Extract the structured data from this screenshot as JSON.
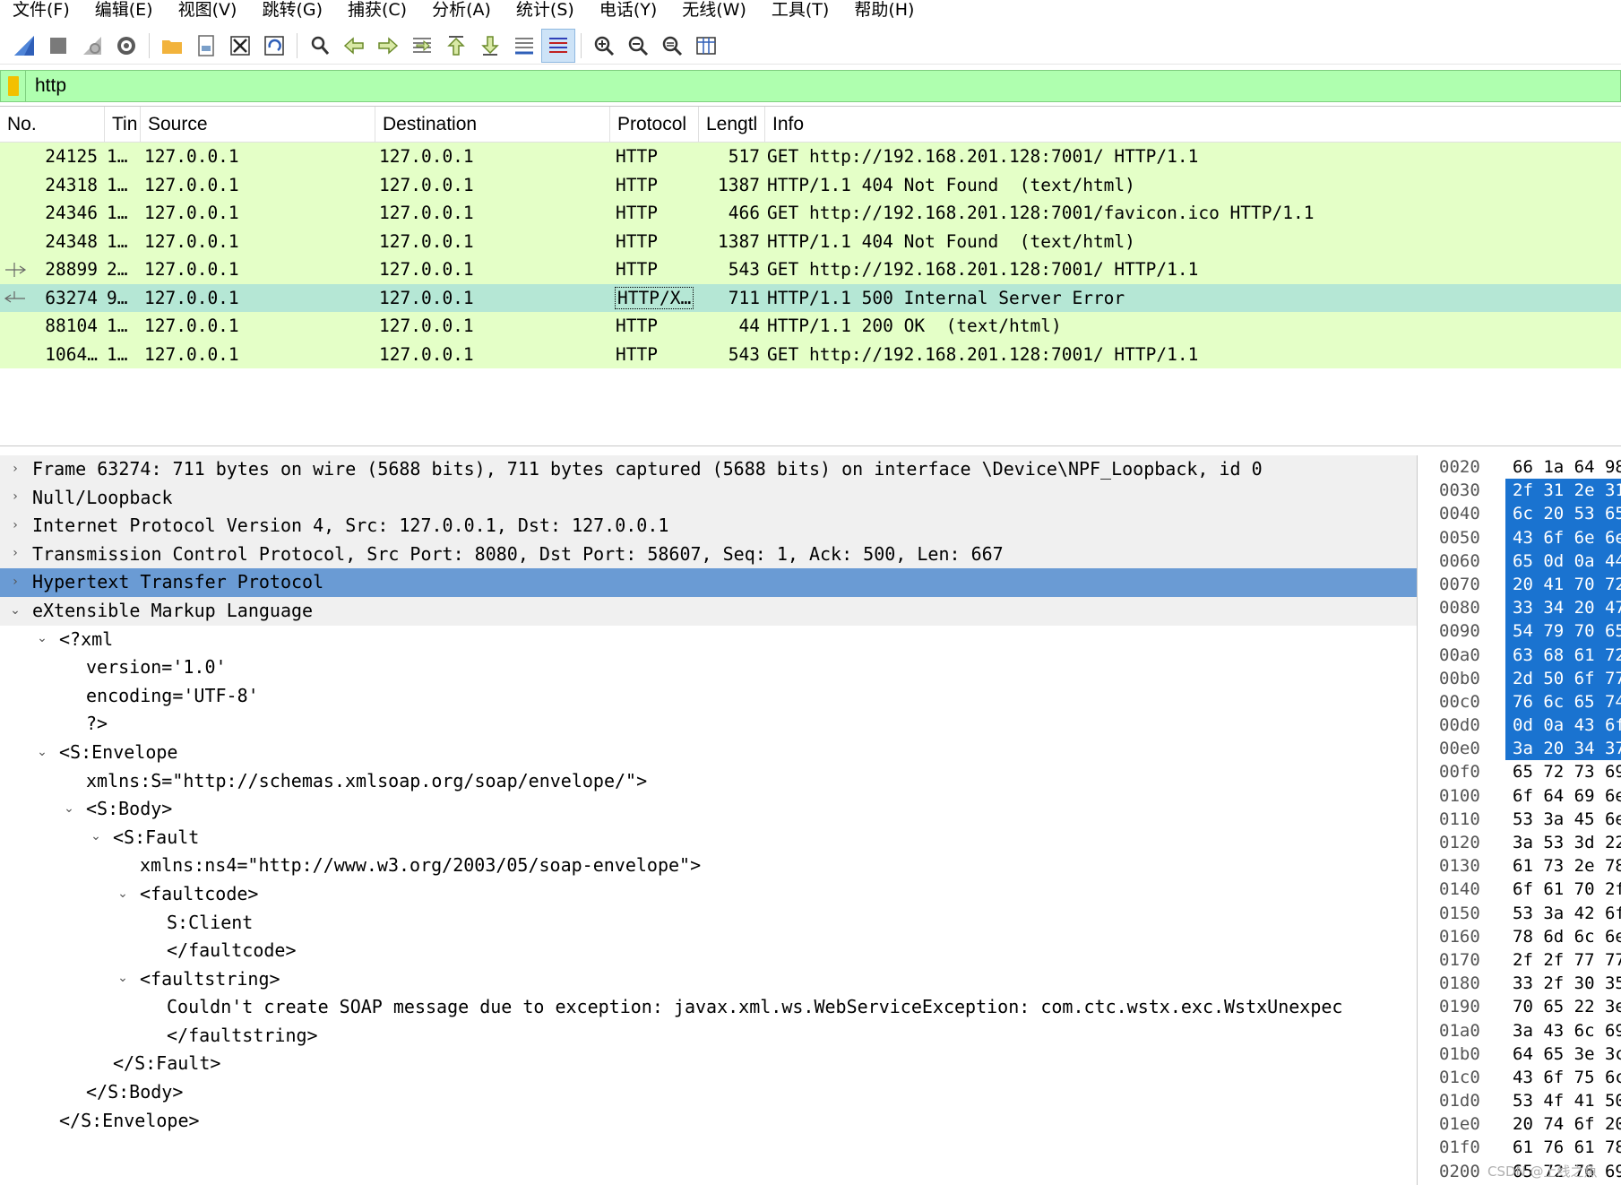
{
  "menu": [
    "文件(F)",
    "编辑(E)",
    "视图(V)",
    "跳转(G)",
    "捕获(C)",
    "分析(A)",
    "统计(S)",
    "电话(Y)",
    "无线(W)",
    "工具(T)",
    "帮助(H)"
  ],
  "toolbar": {
    "buttons": [
      "start-capture-icon",
      "stop-capture-icon",
      "restart-capture-icon",
      "capture-options-icon",
      "open-file-icon",
      "file-set-icon",
      "close-file-icon",
      "reload-file-icon",
      "find-packet-icon",
      "go-back-icon",
      "go-forward-icon",
      "go-to-packet-icon",
      "first-packet-icon",
      "last-packet-icon",
      "auto-scroll-icon",
      "colorize-icon",
      "zoom-in-icon",
      "zoom-out-icon",
      "normal-size-icon",
      "resize-columns-icon"
    ]
  },
  "filter": {
    "value": "http"
  },
  "packet_list": {
    "columns": [
      "No.",
      "Tin",
      "Source",
      "Destination",
      "Protocol",
      "Lengtl",
      "Info"
    ],
    "rows": [
      {
        "no": "24125",
        "time": "1…",
        "src": "127.0.0.1",
        "dst": "127.0.0.1",
        "proto": "HTTP",
        "len": "517",
        "info": "GET http://192.168.201.128:7001/ HTTP/1.1"
      },
      {
        "no": "24318",
        "time": "1…",
        "src": "127.0.0.1",
        "dst": "127.0.0.1",
        "proto": "HTTP",
        "len": "1387",
        "info": "HTTP/1.1 404 Not Found  (text/html)"
      },
      {
        "no": "24346",
        "time": "1…",
        "src": "127.0.0.1",
        "dst": "127.0.0.1",
        "proto": "HTTP",
        "len": "466",
        "info": "GET http://192.168.201.128:7001/favicon.ico HTTP/1.1"
      },
      {
        "no": "24348",
        "time": "1…",
        "src": "127.0.0.1",
        "dst": "127.0.0.1",
        "proto": "HTTP",
        "len": "1387",
        "info": "HTTP/1.1 404 Not Found  (text/html)"
      },
      {
        "no": "28899",
        "time": "2…",
        "src": "127.0.0.1",
        "dst": "127.0.0.1",
        "proto": "HTTP",
        "len": "543",
        "info": "GET http://192.168.201.128:7001/ HTTP/1.1"
      },
      {
        "no": "63274",
        "time": "9…",
        "src": "127.0.0.1",
        "dst": "127.0.0.1",
        "proto": "HTTP/X…",
        "len": "711",
        "info": "HTTP/1.1 500 Internal Server Error"
      },
      {
        "no": "88104",
        "time": "1…",
        "src": "127.0.0.1",
        "dst": "127.0.0.1",
        "proto": "HTTP",
        "len": "44",
        "info": "HTTP/1.1 200 OK  (text/html)"
      },
      {
        "no": "1064…",
        "time": "1…",
        "src": "127.0.0.1",
        "dst": "127.0.0.1",
        "proto": "HTTP",
        "len": "543",
        "info": "GET http://192.168.201.128:7001/ HTTP/1.1"
      }
    ]
  },
  "details": [
    {
      "text": "Frame 63274: 711 bytes on wire (5688 bits), 711 bytes captured (5688 bits) on interface \\Device\\NPF_Loopback, id 0",
      "expander": "›"
    },
    {
      "text": "Null/Loopback",
      "expander": "›"
    },
    {
      "text": "Internet Protocol Version 4, Src: 127.0.0.1, Dst: 127.0.0.1",
      "expander": "›"
    },
    {
      "text": "Transmission Control Protocol, Src Port: 8080, Dst Port: 58607, Seq: 1, Ack: 500, Len: 667",
      "expander": "›"
    },
    {
      "text": "Hypertext Transfer Protocol",
      "expander": "›"
    },
    {
      "text": "eXtensible Markup Language",
      "expander": "⌄"
    },
    {
      "text": "<?xml",
      "expander": "⌄"
    },
    {
      "text": "version='1.0'",
      "expander": ""
    },
    {
      "text": "encoding='UTF-8'",
      "expander": ""
    },
    {
      "text": "?>",
      "expander": ""
    },
    {
      "text": "<S:Envelope",
      "expander": "⌄"
    },
    {
      "text": "xmlns:S=\"http://schemas.xmlsoap.org/soap/envelope/\">",
      "expander": ""
    },
    {
      "text": "<S:Body>",
      "expander": "⌄"
    },
    {
      "text": "<S:Fault",
      "expander": "⌄"
    },
    {
      "text": "xmlns:ns4=\"http://www.w3.org/2003/05/soap-envelope\">",
      "expander": ""
    },
    {
      "text": "<faultcode>",
      "expander": "⌄"
    },
    {
      "text": "S:Client",
      "expander": ""
    },
    {
      "text": "</faultcode>",
      "expander": ""
    },
    {
      "text": "<faultstring>",
      "expander": "⌄"
    },
    {
      "text": "Couldn't create SOAP message due to exception: javax.xml.ws.WebServiceException: com.ctc.wstx.exc.WstxUnexpec",
      "expander": ""
    },
    {
      "text": "</faultstring>",
      "expander": ""
    },
    {
      "text": "</S:Fault>",
      "expander": ""
    },
    {
      "text": "</S:Body>",
      "expander": ""
    },
    {
      "text": "</S:Envelope>",
      "expander": ""
    }
  ],
  "hex": [
    {
      "off": "0020",
      "bytes": "66 1a 64 98"
    },
    {
      "off": "0030",
      "bytes": "2f 31 2e 31"
    },
    {
      "off": "0040",
      "bytes": "6c 20 53 65"
    },
    {
      "off": "0050",
      "bytes": "43 6f 6e 6e"
    },
    {
      "off": "0060",
      "bytes": "65 0d 0a 44"
    },
    {
      "off": "0070",
      "bytes": "20 41 70 72"
    },
    {
      "off": "0080",
      "bytes": "33 34 20 47"
    },
    {
      "off": "0090",
      "bytes": "54 79 70 65"
    },
    {
      "off": "00a0",
      "bytes": "63 68 61 72"
    },
    {
      "off": "00b0",
      "bytes": "2d 50 6f 77"
    },
    {
      "off": "00c0",
      "bytes": "76 6c 65 74"
    },
    {
      "off": "00d0",
      "bytes": "0d 0a 43 6f"
    },
    {
      "off": "00e0",
      "bytes": "3a 20 34 37"
    },
    {
      "off": "00f0",
      "bytes": "65 72 73 69"
    },
    {
      "off": "0100",
      "bytes": "6f 64 69 6e"
    },
    {
      "off": "0110",
      "bytes": "53 3a 45 6e"
    },
    {
      "off": "0120",
      "bytes": "3a 53 3d 22"
    },
    {
      "off": "0130",
      "bytes": "61 73 2e 78"
    },
    {
      "off": "0140",
      "bytes": "6f 61 70 2f"
    },
    {
      "off": "0150",
      "bytes": "53 3a 42 6f"
    },
    {
      "off": "0160",
      "bytes": "78 6d 6c 6e"
    },
    {
      "off": "0170",
      "bytes": "2f 2f 77 77"
    },
    {
      "off": "0180",
      "bytes": "33 2f 30 35"
    },
    {
      "off": "0190",
      "bytes": "70 65 22 3e"
    },
    {
      "off": "01a0",
      "bytes": "3a 43 6c 69"
    },
    {
      "off": "01b0",
      "bytes": "64 65 3e 3c"
    },
    {
      "off": "01c0",
      "bytes": "43 6f 75 6c"
    },
    {
      "off": "01d0",
      "bytes": "53 4f 41 50"
    },
    {
      "off": "01e0",
      "bytes": "20 74 6f 20"
    },
    {
      "off": "01f0",
      "bytes": "61 76 61 78"
    },
    {
      "off": "0200",
      "bytes": "65 72 76 69"
    }
  ],
  "watermark": "CSDN @上线之魚"
}
